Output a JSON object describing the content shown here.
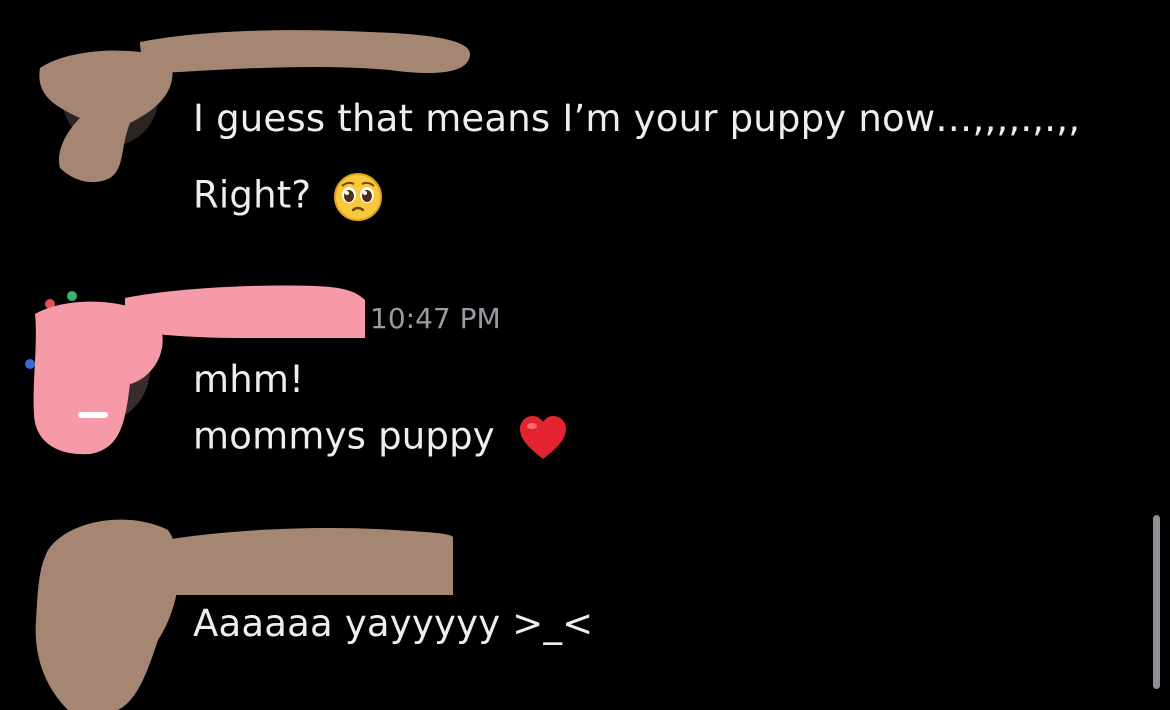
{
  "messages": [
    {
      "lines": [
        "I guess that means I’m your puppy now…,,,,.,.,,",
        "Right?"
      ],
      "emoji": "pleading-face"
    },
    {
      "timestamp": "10:47 PM",
      "lines": [
        "mhm!",
        "mommys puppy"
      ],
      "emoji": "red-heart"
    },
    {
      "lines": [
        "Aaaaaa yayyyyy >_<"
      ]
    }
  ],
  "colors": {
    "background": "#000000",
    "message_text": "#eceef1",
    "timestamp": "#9b9ca3",
    "redaction_tan": "#a58672",
    "redaction_pink": "#f79aa8",
    "scrollbar": "#8e9097"
  }
}
